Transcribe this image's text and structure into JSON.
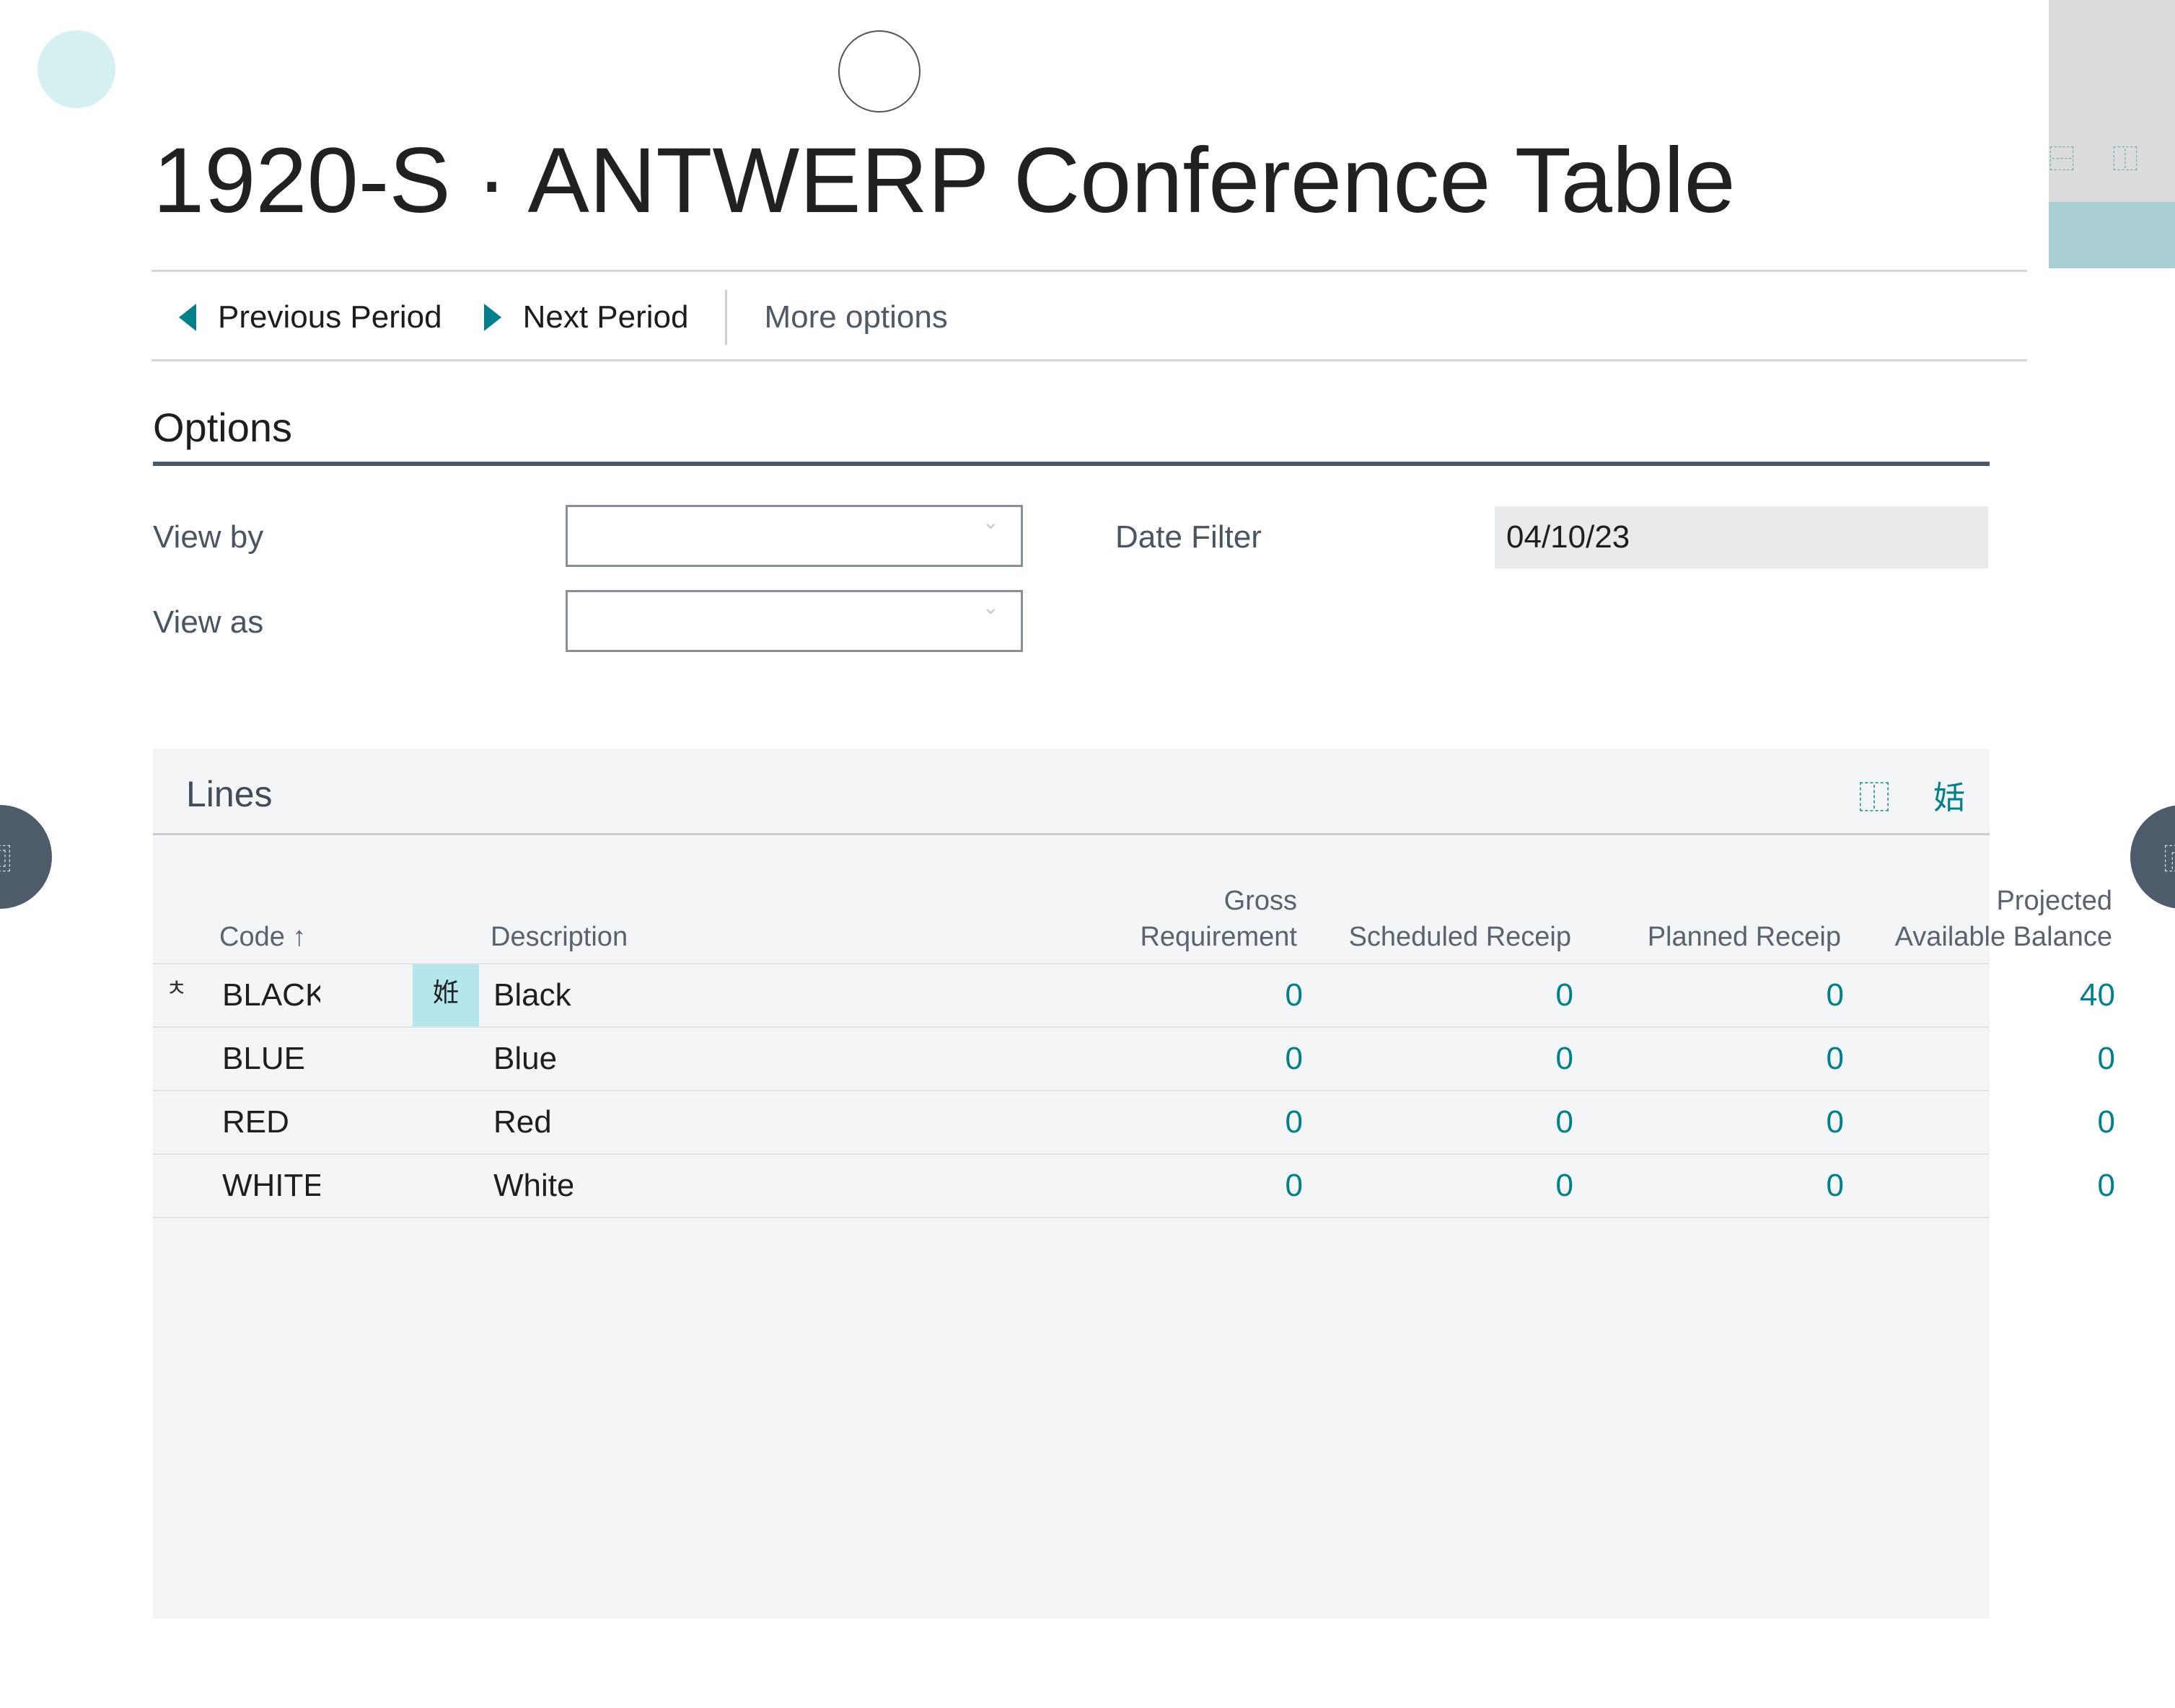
{
  "page": {
    "title": "1920-S · ANTWERP Conference Table"
  },
  "actions": {
    "previous_period": "Previous Period",
    "next_period": "Next Period",
    "more_options": "More options"
  },
  "options": {
    "section_title": "Options",
    "view_by_label": "View by",
    "view_by_value": "",
    "view_as_label": "View as",
    "view_as_value": "",
    "date_filter_label": "Date Filter",
    "date_filter_value": "04/10/23"
  },
  "lines": {
    "title": "Lines",
    "columns": {
      "code": "Code",
      "code_sort_indicator": "↑",
      "description": "Description",
      "gross_line1": "Gross",
      "gross_line2": "Requirement",
      "scheduled": "Scheduled Receip",
      "planned": "Planned Receip",
      "projected_line1": "Projected",
      "projected_line2": "Available Balance"
    },
    "rows": [
      {
        "code": "BLACK",
        "description": "Black",
        "gross": "0",
        "scheduled": "0",
        "planned": "0",
        "projected": "40"
      },
      {
        "code": "BLUE",
        "description": "Blue",
        "gross": "0",
        "scheduled": "0",
        "planned": "0",
        "projected": "0"
      },
      {
        "code": "RED",
        "description": "Red",
        "gross": "0",
        "scheduled": "0",
        "planned": "0",
        "projected": "0"
      },
      {
        "code": "WHITE",
        "description": "White",
        "gross": "0",
        "scheduled": "0",
        "planned": "0",
        "projected": "0"
      }
    ]
  },
  "icons": {
    "row_marker": "ㅊ",
    "row_action": "姙",
    "lines_share": "⿰",
    "lines_expand": "姡",
    "dropdown_chevron": "⌄",
    "strip_icon_1": "⿱",
    "strip_icon_2": "⿰",
    "nav_left": "⿴",
    "nav_right": "⿸"
  },
  "colors": {
    "accent": "#00808a",
    "selected_cell": "#b4e6ec",
    "nav_circle": "#4d5b6b"
  }
}
